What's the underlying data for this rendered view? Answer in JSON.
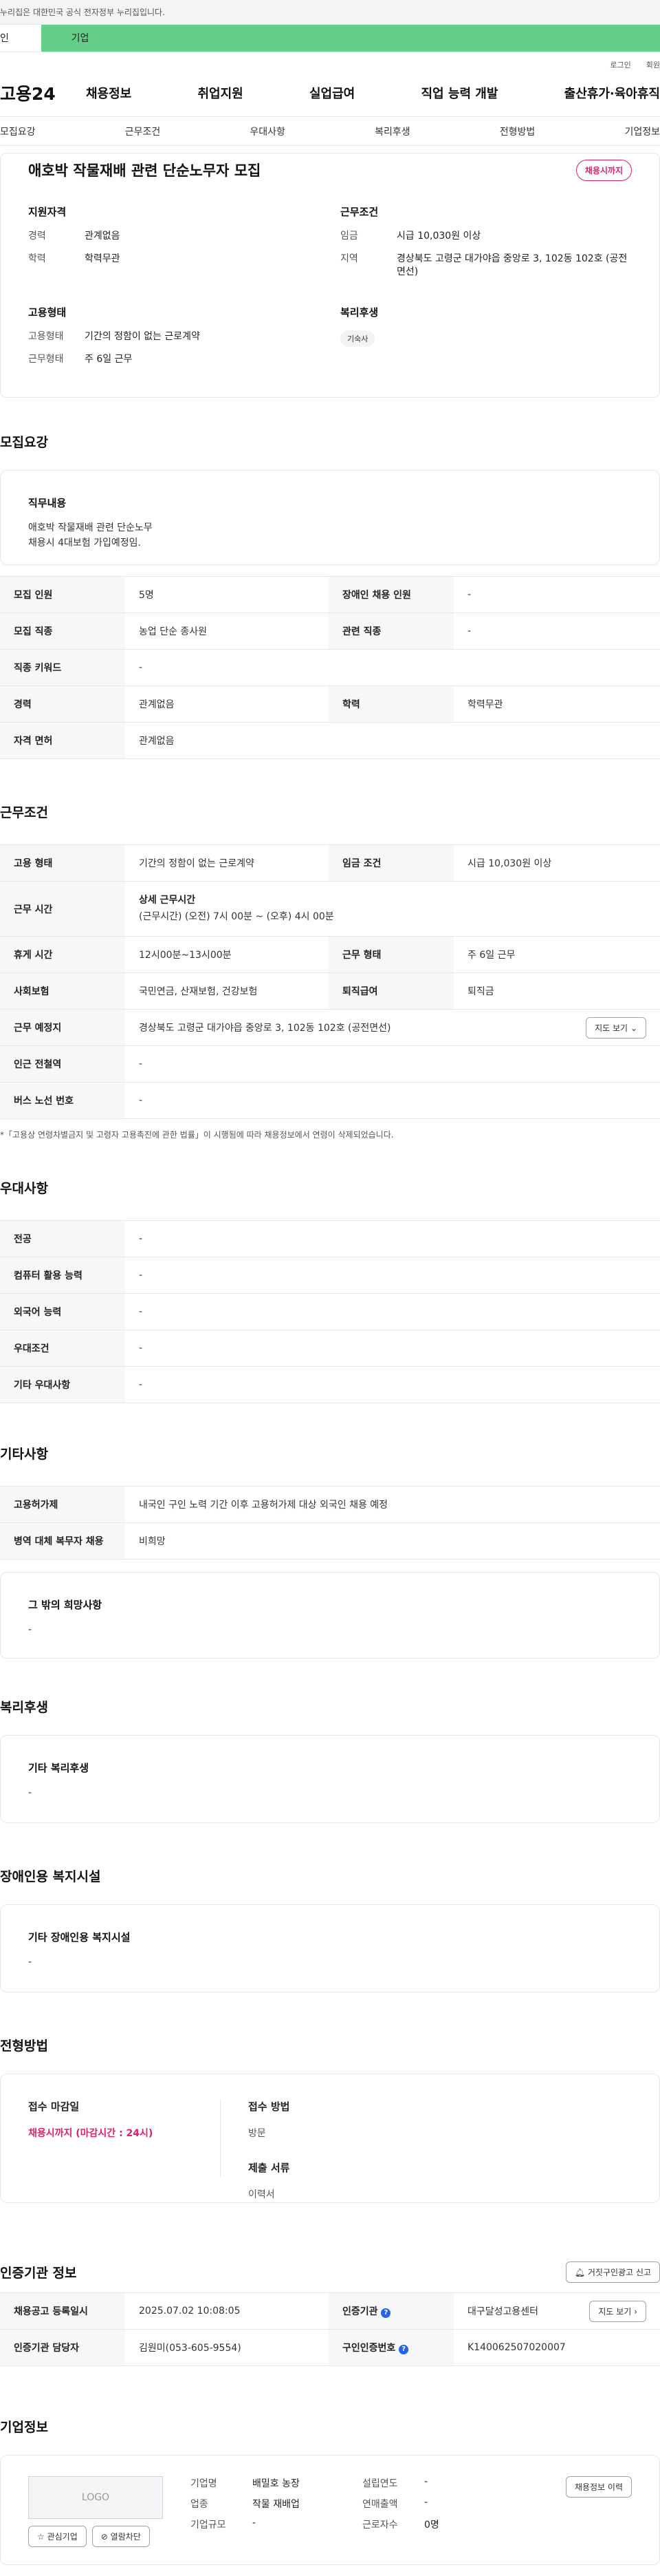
{
  "gov_bar": "누리집은 대한민국 공식 전자정부 누리집입니다.",
  "tabs": [
    "인",
    "기업"
  ],
  "top_links": [
    "로그인",
    "회원"
  ],
  "brand": "고용24",
  "main_menu": [
    "채용정보",
    "취업지원",
    "실업급여",
    "직업 능력 개발",
    "출산휴가·육아휴직"
  ],
  "sub_nav": [
    "모집요강",
    "근무조건",
    "우대사항",
    "복리후생",
    "전형방법",
    "기업정보"
  ],
  "job": {
    "title": "애호박 작물재배 관련 단순노무자 모집",
    "deadline_badge": "채용시까지",
    "qual_title": "지원자격",
    "qual": [
      {
        "k": "경력",
        "v": "관계없음"
      },
      {
        "k": "학력",
        "v": "학력무관"
      }
    ],
    "cond_title": "근무조건",
    "cond": [
      {
        "k": "임금",
        "v": "시급 10,030원 이상"
      },
      {
        "k": "지역",
        "v": "경상북도 고령군 대가야읍 중앙로 3, 102동 102호 (공전면선)"
      }
    ],
    "emp_title": "고용형태",
    "emp": [
      {
        "k": "고용형태",
        "v": "기간의 정함이 없는 근로계약"
      },
      {
        "k": "근무형태",
        "v": "주 6일 근무"
      }
    ],
    "welfare_title": "복리후생",
    "welfare_chip": "기숙사"
  },
  "recruit": {
    "title": "모집요강",
    "duty_title": "직무내용",
    "duty_lines": [
      "애호박 작물재배 관련 단순노무",
      "채용시 4대보험 가입예정임."
    ],
    "rows": [
      [
        {
          "th": "모집 인원",
          "td": "5명"
        },
        {
          "th": "장애인 채용 인원",
          "td": "-"
        }
      ],
      [
        {
          "th": "모집 직종",
          "td": "농업 단순 종사원"
        },
        {
          "th": "관련 직종",
          "td": "-"
        }
      ],
      [
        {
          "th": "직종 키워드",
          "td": "-"
        }
      ],
      [
        {
          "th": "경력",
          "td": "관계없음"
        },
        {
          "th": "학력",
          "td": "학력무관"
        }
      ],
      [
        {
          "th": "자격 면허",
          "td": "관계없음"
        }
      ]
    ]
  },
  "work": {
    "title": "근무조건",
    "r1": [
      {
        "th": "고용 형태",
        "td": "기간의 정함이 없는 근로계약"
      },
      {
        "th": "임금 조건",
        "td": "시급 10,030원 이상"
      }
    ],
    "hours_th": "근무 시간",
    "hours_label": "상세 근무시간",
    "hours_value": "(근무시간) (오전) 7시 00분 ~ (오후) 4시 00분",
    "r3": [
      {
        "th": "휴게 시간",
        "td": "12시00분~13시00분"
      },
      {
        "th": "근무 형태",
        "td": "주 6일 근무"
      }
    ],
    "r4": [
      {
        "th": "사회보험",
        "td": "국민연금, 산재보험, 건강보험"
      },
      {
        "th": "퇴직급여",
        "td": "퇴직금"
      }
    ],
    "loc_th": "근무 예정지",
    "loc_td": "경상북도 고령군 대가야읍 중앙로 3, 102동 102호 (공전면선)",
    "map_btn": "지도 보기",
    "r6": {
      "th": "인근 전철역",
      "td": "-"
    },
    "r7": {
      "th": "버스 노선 번호",
      "td": "-"
    },
    "note": "*「고용상 연령차별금지 및 고령자 고용촉진에 관한 법률」이 시행됨에 따라 채용정보에서 연령이 삭제되었습니다."
  },
  "pref": {
    "title": "우대사항",
    "rows": [
      {
        "th": "전공",
        "td": "-"
      },
      {
        "th": "컴퓨터 활용 능력",
        "td": "-"
      },
      {
        "th": "외국어 능력",
        "td": "-"
      },
      {
        "th": "우대조건",
        "td": "-"
      },
      {
        "th": "기타 우대사항",
        "td": "-"
      }
    ]
  },
  "etc": {
    "title": "기타사항",
    "rows": [
      {
        "th": "고용허가제",
        "td": "내국인 구인 노력 기간 이후 고용허가제 대상 외국인 채용 예정"
      },
      {
        "th": "병역 대체 복무자 채용",
        "td": "비희망"
      }
    ],
    "other_title": "그 밖의 희망사항",
    "other_value": "-"
  },
  "welfare": {
    "title": "복리후생",
    "box_title": "기타 복리후생",
    "box_value": "-"
  },
  "disab": {
    "title": "장애인용 복지시설",
    "box_title": "기타 장애인용 복지시설",
    "box_value": "-"
  },
  "process": {
    "title": "전형방법",
    "deadline_title": "접수 마감일",
    "deadline_value": "채용시까지 (마감시간 : 24시)",
    "method_title": "접수 방법",
    "method_value": "방문",
    "docs_title": "제출 서류",
    "docs_value": "이력서"
  },
  "cert": {
    "title": "인증기관 정보",
    "report_btn": "거짓구인광고 신고",
    "r1": [
      {
        "th": "채용공고 등록일시",
        "td": "2025.07.02 10:08:05"
      },
      {
        "th": "인증기관",
        "td": "대구달성고용센터"
      }
    ],
    "map_btn": "지도 보기",
    "r2": [
      {
        "th": "인증기관 담당자",
        "td": "김원미(053-605-9554)"
      },
      {
        "th": "구인인증번호",
        "td": "K140062507020007"
      }
    ]
  },
  "company": {
    "title": "기업정보",
    "logo": "LOGO",
    "fav_btn": "관심기업",
    "block_btn": "열람차단",
    "history_btn": "채용정보 이력",
    "fields": [
      {
        "k": "기업명",
        "v": "배밀호 농장"
      },
      {
        "k": "설립연도",
        "v": "-"
      },
      {
        "k": "업종",
        "v": "작물 재배업"
      },
      {
        "k": "연매출액",
        "v": "-"
      },
      {
        "k": "기업규모",
        "v": "-"
      },
      {
        "k": "근로자수",
        "v": "0명"
      }
    ]
  }
}
